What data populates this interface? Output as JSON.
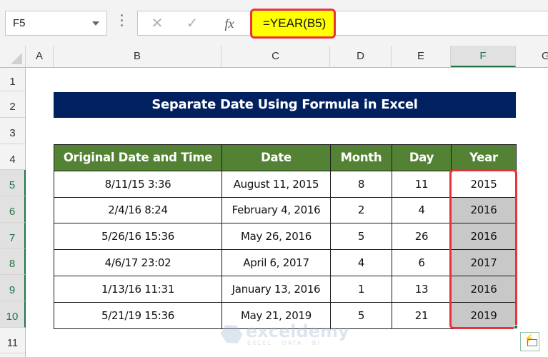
{
  "formula_bar": {
    "name_box": "F5",
    "cancel_icon": "✕",
    "enter_icon": "✓",
    "fx_label": "fx",
    "formula": "=YEAR(B5)"
  },
  "columns": [
    "A",
    "B",
    "C",
    "D",
    "E",
    "F",
    "G"
  ],
  "selected_column": "F",
  "rows": [
    "1",
    "2",
    "3",
    "4",
    "5",
    "6",
    "7",
    "8",
    "9",
    "10",
    "11"
  ],
  "selected_rows": [
    "5",
    "6",
    "7",
    "8",
    "9",
    "10"
  ],
  "sheet": {
    "title": "Separate Date Using Formula in Excel",
    "headers": [
      "Original Date and Time",
      "Date",
      "Month",
      "Day",
      "Year"
    ],
    "data": [
      [
        "8/11/15 3:36",
        "August 11, 2015",
        "8",
        "11",
        "2015"
      ],
      [
        "2/4/16 8:24",
        "February 4, 2016",
        "2",
        "4",
        "2016"
      ],
      [
        "5/26/16 15:36",
        "May 26, 2016",
        "5",
        "26",
        "2016"
      ],
      [
        "4/6/17 23:02",
        "April 6, 2017",
        "4",
        "6",
        "2017"
      ],
      [
        "1/13/16 11:31",
        "January 13, 2016",
        "1",
        "13",
        "2016"
      ],
      [
        "5/21/19 15:36",
        "May 21, 2019",
        "5",
        "21",
        "2019"
      ]
    ]
  },
  "watermark": {
    "name": "exceldemy",
    "tagline": "EXCEL · DATA · BI"
  },
  "colors": {
    "title_bg": "#002060",
    "header_bg": "#548235",
    "highlight_red": "#e8323c",
    "formula_highlight": "#ffff00",
    "selection_green": "#217346",
    "filled_cell_grey": "#c8c8c8"
  }
}
